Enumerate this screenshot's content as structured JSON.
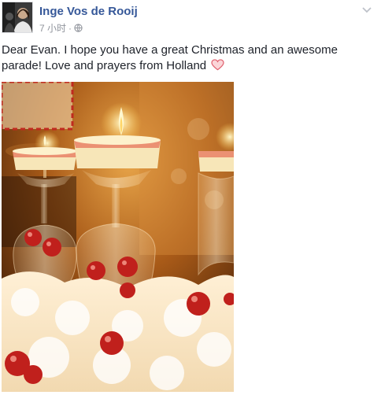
{
  "post": {
    "author_name": "Inge Vos de Rooij",
    "timestamp": "7 小时",
    "separator": "·",
    "privacy_icon": "globe-icon",
    "options_icon": "chevron-down-icon",
    "message": "Dear Evan. I hope you have a great Christmas and an awesome parade! Love and prayers from Holland",
    "message_emoji": "heart-icon",
    "photo": {
      "description_icon": "photo",
      "colors": {
        "bg": "#6b3a10",
        "glow": "#f3c46a",
        "ornament": "#c0201c",
        "snow": "#fff4e0"
      }
    }
  },
  "colors": {
    "author": "#365899",
    "meta": "#90949c",
    "text": "#1d2129"
  }
}
